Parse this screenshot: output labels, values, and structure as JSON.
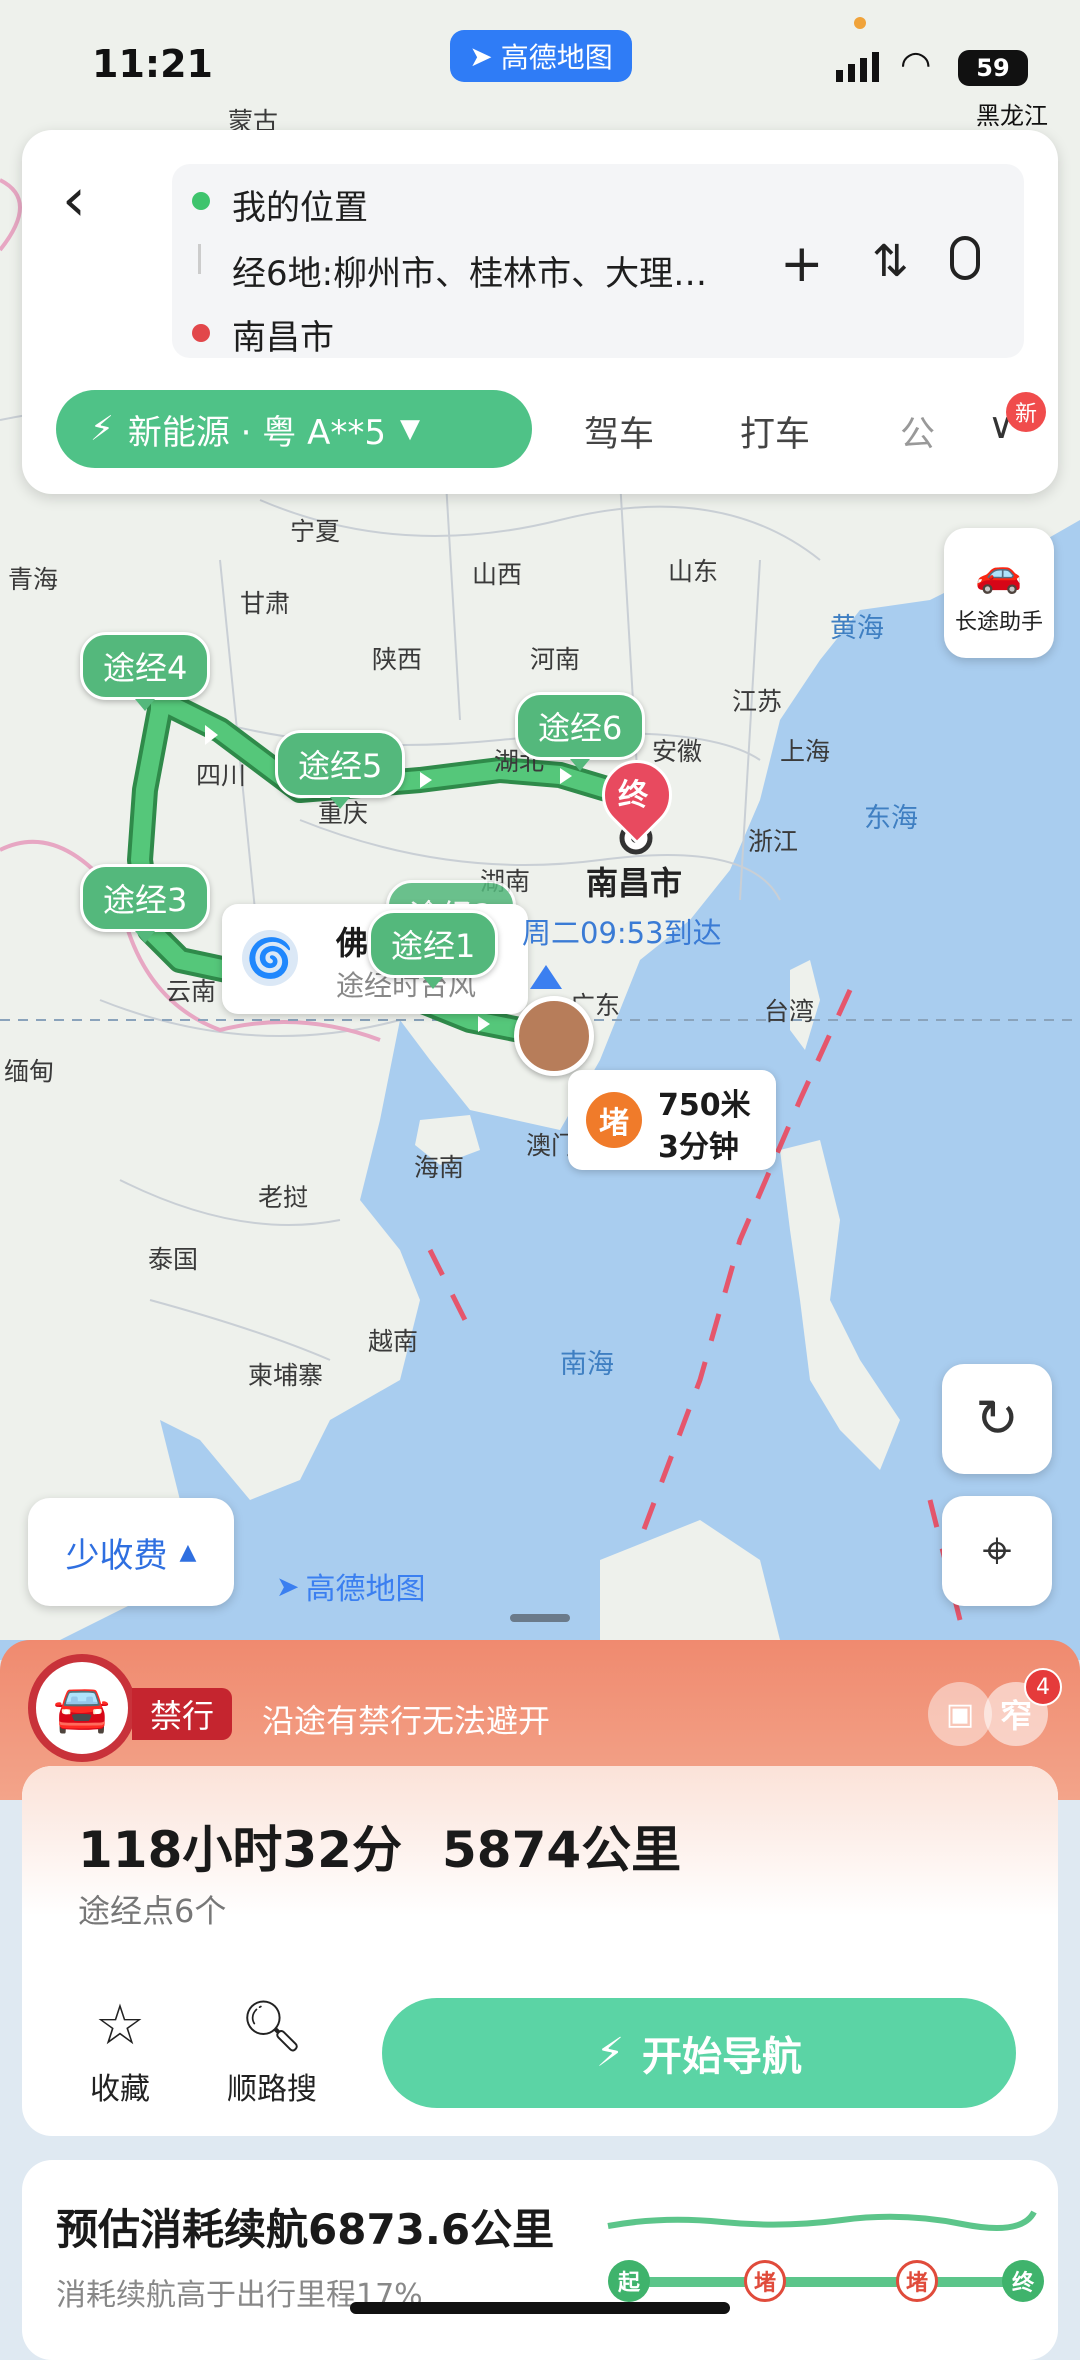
{
  "status_bar": {
    "time": "11:21",
    "app_name": "高德地图",
    "battery": "59"
  },
  "top_card": {
    "origin": "我的位置",
    "via": "经6地:柳州市、桂林市、大理…",
    "destination": "南昌市",
    "mode_pill": "新能源 · 粤 A**5",
    "tabs": [
      "驾车",
      "打车",
      "公"
    ],
    "new_badge": "新"
  },
  "map": {
    "labels": {
      "heilongjiang": "黑龙江",
      "neimeng": "蒙古",
      "qinghai": "青海",
      "ningxia": "宁夏",
      "gansu": "甘肃",
      "shanxi": "山西",
      "shandong": "山东",
      "shaanxi": "陕西",
      "henan": "河南",
      "jiangsu": "江苏",
      "sichuan": "四川",
      "hubei": "湖北",
      "anhui": "安徽",
      "shanghai": "上海",
      "chongqing": "重庆",
      "zhejiang": "浙江",
      "hunan": "湖南",
      "yunnan": "云南",
      "guangdong": "广东",
      "taiwan": "台湾",
      "miandian": "缅甸",
      "hainan": "海南",
      "aomen": "澳门",
      "laowo": "老挝",
      "taiguo": "泰国",
      "yuenan": "越南",
      "jianpuzhai": "柬埔寨"
    },
    "seas": {
      "huanghai": "黄海",
      "donghai": "东海",
      "nanhai": "南海"
    },
    "waypoints": [
      "途经1",
      "途经2",
      "途经3",
      "途经4",
      "途经5",
      "途经6"
    ],
    "destination_label": "南昌市",
    "destination_marker": "终",
    "arrival": "周二09:53到达",
    "typhoon_title": "佛",
    "typhoon_sub": "途经时台风",
    "traffic_badge": "堵",
    "traffic_distance": "750米",
    "traffic_time": "3分钟",
    "watermark": "高德地图",
    "long_trip_assistant": "长途助手",
    "toll_option": "少收费"
  },
  "ban": {
    "tag": "禁行",
    "text": "沿途有禁行无法避开",
    "narrow": "窄",
    "narrow_count": "4"
  },
  "summary": {
    "duration": "118小时32分",
    "distance": "5874公里",
    "via_count": "途经点6个",
    "favorite": "收藏",
    "nearby_search": "顺路搜",
    "start_nav": "开始导航"
  },
  "energy": {
    "title": "预估消耗续航6873.6公里",
    "subtitle": "消耗续航高于出行里程17%",
    "nodes": [
      "起",
      "堵",
      "堵",
      "终"
    ]
  },
  "colors": {
    "route": "#4fb46a",
    "accent": "#4fc287",
    "ban": "#e85a3c",
    "map_water": "#a9cdef",
    "land": "#eef1ec"
  }
}
